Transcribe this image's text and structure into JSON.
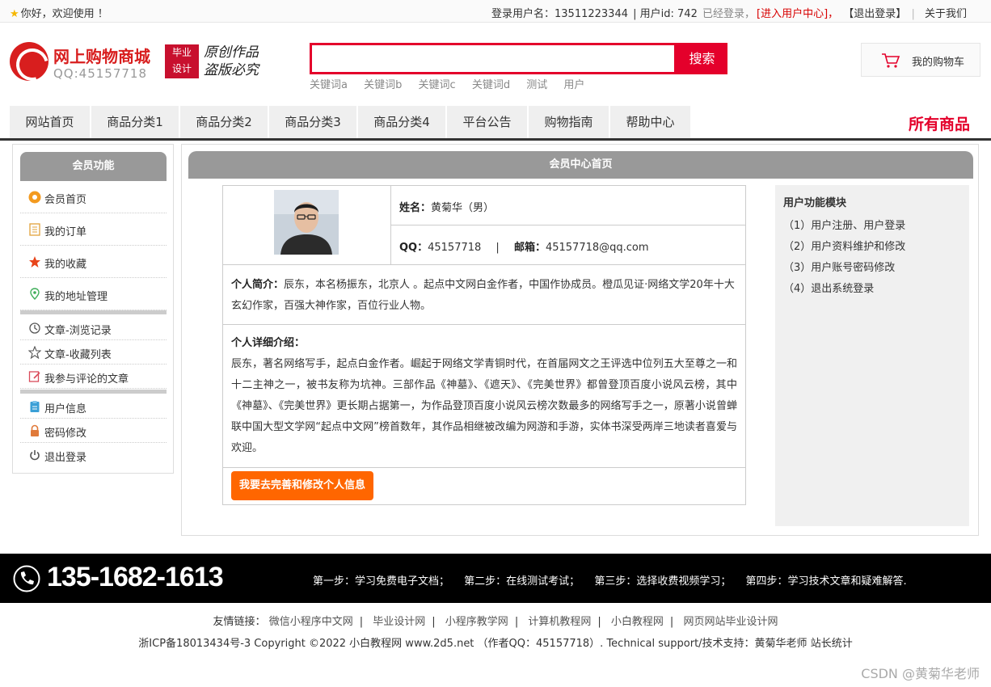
{
  "topbar": {
    "welcome": "你好，欢迎使用 ！",
    "user_label": "登录用户名：13511223344",
    "user_id": "| 用户id: 742",
    "logged_in": "已经登录，",
    "enter_center": "[进入用户中心]，",
    "logout": "【退出登录】",
    "about": "关于我们"
  },
  "header": {
    "site_name": "网上购物商城",
    "qq": "QQ:45157718",
    "badge_line1": "毕业",
    "badge_line2": "设计",
    "slogan_line1": "原创作品",
    "slogan_line2": "盗版必究",
    "search_value": "",
    "search_button": "搜索",
    "keywords": [
      "关键词a",
      "关键词b",
      "关键词c",
      "关键词d",
      "测试",
      "用户"
    ],
    "cart_label": "我的购物车"
  },
  "nav": {
    "items": [
      "网站首页",
      "商品分类1",
      "商品分类2",
      "商品分类3",
      "商品分类4",
      "平台公告",
      "购物指南",
      "帮助中心"
    ],
    "all_goods": "所有商品"
  },
  "sidebar": {
    "title": "会员功能",
    "items": [
      "会员首页",
      "我的订单",
      "我的收藏",
      "我的地址管理",
      "文章-浏览记录",
      "文章-收藏列表",
      "我参与评论的文章",
      "用户信息",
      "密码修改",
      "退出登录"
    ]
  },
  "main": {
    "title": "会员中心首页",
    "name_label": "姓名：",
    "name_value": "黄菊华（男）",
    "qq_label": "QQ：",
    "qq_value": "45157718",
    "divider": "|",
    "email_label": "邮箱：",
    "email_value": "45157718@qq.com",
    "bio_label": "个人简介：",
    "bio_text": "辰东，本名杨振东，北京人 。起点中文网白金作者，中国作协成员。橙瓜见证·网络文学20年十大玄幻作家，百强大神作家，百位行业人物。",
    "detail_label": "个人详细介绍：",
    "detail_text": "辰东，著名网络写手，起点白金作者。崛起于网络文学青铜时代，在首届网文之王评选中位列五大至尊之一和十二主神之一，被书友称为坑神。三部作品《神墓》、《遮天》、《完美世界》都曾登顶百度小说风云榜，其中《神墓》、《完美世界》更长期占据第一，为作品登顶百度小说风云榜次数最多的网络写手之一，原著小说曾蝉联中国大型文学网“起点中文网”榜首数年，其作品相继被改编为网游和手游，实体书深受两岸三地读者喜爱与欢迎。",
    "edit_button": "我要去完善和修改个人信息"
  },
  "functions": {
    "title": "用户功能模块",
    "items": [
      "（1）用户注册、用户登录",
      "（2）用户资料维护和修改",
      "（3）用户账号密码修改",
      "（4）退出系统登录"
    ]
  },
  "footer": {
    "phone": "135-1682-1613",
    "steps": [
      "第一步：学习免费电子文档；",
      "第二步：在线测试考试；",
      "第三步：选择收费视频学习；",
      "第四步：学习技术文章和疑难解答."
    ],
    "links_label": "友情链接：",
    "links": [
      "微信小程序中文网",
      "毕业设计网",
      "小程序教学网",
      "计算机教程网",
      "小白教程网",
      "网页网站毕业设计网"
    ],
    "copyright": "浙ICP备18013434号-3 Copyright ©2022 小白教程网 www.2d5.net （作者QQ：45157718）. Technical support/技术支持：黄菊华老师 站长统计",
    "watermark": "CSDN @黄菊华老师"
  },
  "colors": {
    "accent_red": "#e4002b",
    "button_orange": "#ff6600",
    "panel_gray": "#999999"
  }
}
